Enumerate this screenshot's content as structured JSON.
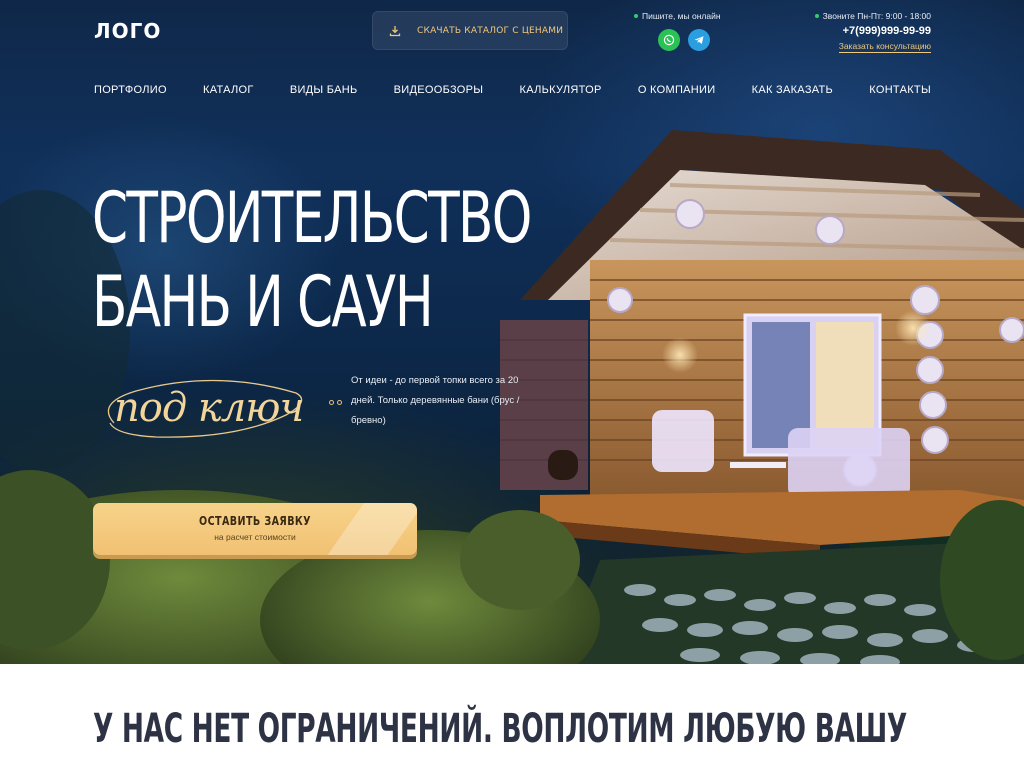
{
  "header": {
    "logo": "ЛОГО",
    "catalog_button": "СКАЧАТЬ КАТАЛОГ С ЦЕНАМИ",
    "online_text": "Пишите, мы онлайн",
    "hours_text": "Звоните Пн-Пт: 9:00 - 18:00",
    "phone": "+7(999)999-99-99",
    "consult_link": "Заказать консультацию"
  },
  "nav": {
    "items": [
      "ПОРТФОЛИО",
      "КАТАЛОГ",
      "ВИДЫ БАНЬ",
      "ВИДЕООБЗОРЫ",
      "КАЛЬКУЛЯТОР",
      "О КОМПАНИИ",
      "КАК ЗАКАЗАТЬ",
      "КОНТАКТЫ"
    ]
  },
  "hero": {
    "title_line1": "СТРОИТЕЛЬСТВО",
    "title_line2": "БАНЬ И САУН",
    "script": "под ключ",
    "lead": "От идеи - до первой топки всего за 20 дней. Только деревянные бани (брус / бревно)",
    "cta_title": "ОСТАВИТЬ ЗАЯВКУ",
    "cta_sub": "на расчет стоимости"
  },
  "section": {
    "heading": "У НАС НЕТ ОГРАНИЧЕНИЙ. ВОПЛОТИМ ЛЮБУЮ ВАШУ"
  },
  "colors": {
    "accent": "#f3c77a",
    "navy": "#0f2849",
    "whatsapp": "#2bc255",
    "telegram": "#2b9ee0",
    "heading_dark": "#2d3344"
  },
  "icons": [
    "download-icon",
    "whatsapp-icon",
    "telegram-icon",
    "online-dot-icon"
  ]
}
